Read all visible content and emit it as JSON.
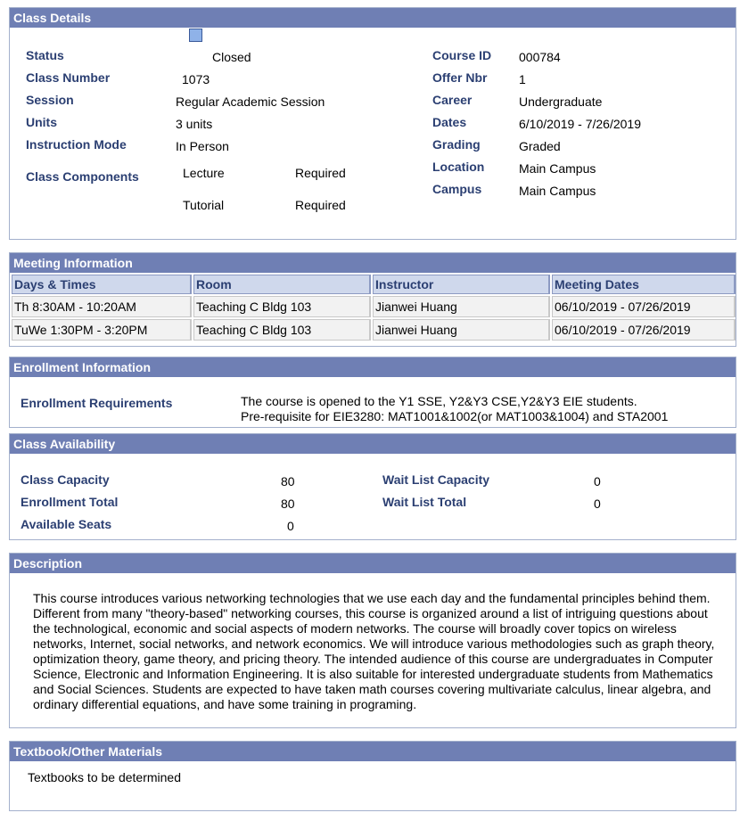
{
  "class_details": {
    "title": "Class Details",
    "status_label": "Status",
    "status_value": "Closed",
    "class_number_label": "Class Number",
    "class_number_value": "1073",
    "session_label": "Session",
    "session_value": "Regular Academic Session",
    "units_label": "Units",
    "units_value": "3 units",
    "instruction_mode_label": "Instruction Mode",
    "instruction_mode_value": "In Person",
    "components_label": "Class Components",
    "components": [
      {
        "name": "Lecture",
        "requirement": "Required"
      },
      {
        "name": "Tutorial",
        "requirement": "Required"
      }
    ],
    "course_id_label": "Course ID",
    "course_id_value": "000784",
    "offer_nbr_label": "Offer Nbr",
    "offer_nbr_value": "1",
    "career_label": "Career",
    "career_value": "Undergraduate",
    "dates_label": "Dates",
    "dates_value": "6/10/2019 - 7/26/2019",
    "grading_label": "Grading",
    "grading_value": "Graded",
    "location_label": "Location",
    "location_value": "Main Campus",
    "campus_label": "Campus",
    "campus_value": "Main Campus"
  },
  "meeting_info": {
    "title": "Meeting Information",
    "headers": [
      "Days & Times",
      "Room",
      "Instructor",
      "Meeting Dates"
    ],
    "rows": [
      [
        "Th 8:30AM - 10:20AM",
        "Teaching C Bldg 103",
        "Jianwei Huang",
        "06/10/2019 - 07/26/2019"
      ],
      [
        "TuWe 1:30PM - 3:20PM",
        "Teaching C Bldg 103",
        "Jianwei Huang",
        "06/10/2019 - 07/26/2019"
      ]
    ]
  },
  "enrollment_info": {
    "title": "Enrollment Information",
    "req_label": "Enrollment Requirements",
    "req_line1": "The course is opened to the Y1 SSE, Y2&Y3 CSE,Y2&Y3 EIE students.",
    "req_line2": "Pre-requisite for EIE3280: MAT1001&1002(or MAT1003&1004) and STA2001"
  },
  "availability": {
    "title": "Class Availability",
    "capacity_label": "Class Capacity",
    "capacity_value": "80",
    "enrollment_total_label": "Enrollment Total",
    "enrollment_total_value": "80",
    "available_seats_label": "Available Seats",
    "available_seats_value": "0",
    "wait_capacity_label": "Wait List Capacity",
    "wait_capacity_value": "0",
    "wait_total_label": "Wait List Total",
    "wait_total_value": "0"
  },
  "description": {
    "title": "Description",
    "text": "This course introduces various networking technologies that we use each day and the fundamental principles behind them. Different from many \"theory-based\" networking courses, this course is organized around a list of intriguing questions about the technological, economic and social aspects of modern networks. The course will broadly cover topics on wireless networks, Internet, social networks, and network economics. We will introduce various methodologies such as graph theory, optimization theory, game theory, and pricing theory. The intended audience of this course are undergraduates in Computer Science, Electronic and Information Engineering. It is also suitable for interested undergraduate students from Mathematics and Social Sciences. Students are expected to have taken math courses covering multivariate calculus, linear algebra, and ordinary differential equations, and have some training in programing."
  },
  "textbook": {
    "title": "Textbook/Other Materials",
    "text": "Textbooks to be determined"
  },
  "colors": {
    "header_bg": "#6f7fb4",
    "label_text": "#2b3f72",
    "column_header_bg": "#cfd8ec"
  }
}
